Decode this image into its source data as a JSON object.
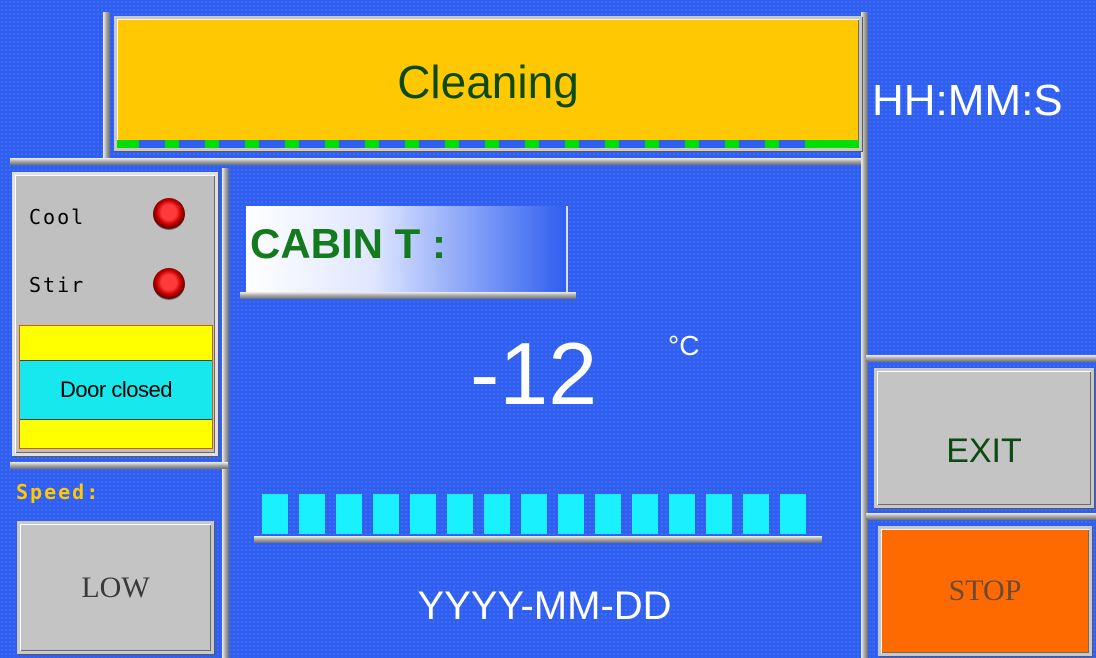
{
  "header": {
    "title": "Cleaning",
    "clock": "HH:MM:S"
  },
  "status": {
    "cool_label": "Cool",
    "stir_label": "Stir",
    "door_status": "Door closed"
  },
  "speed": {
    "label": "Speed:",
    "button_label": "LOW"
  },
  "cabin": {
    "label": "CABIN T :",
    "temperature": "-12",
    "unit": "°C",
    "level_segments": 15,
    "date": "YYYY-MM-DD"
  },
  "controls": {
    "exit_label": "EXIT",
    "stop_label": "STOP"
  },
  "colors": {
    "background": "#2f5ff0",
    "title_panel": "#ffc800",
    "title_text": "#0b4a12",
    "cabin_label_text": "#137a1e",
    "door_bar_yellow": "#ffff00",
    "door_bar_cyan": "#17e8ee",
    "level_segment": "#19f1ff",
    "progress_green": "#00dd00",
    "speed_label": "#ffc800",
    "stop_button": "#ff6a00",
    "exit_button": "#c4c4c4",
    "led_red": "#e00000"
  }
}
